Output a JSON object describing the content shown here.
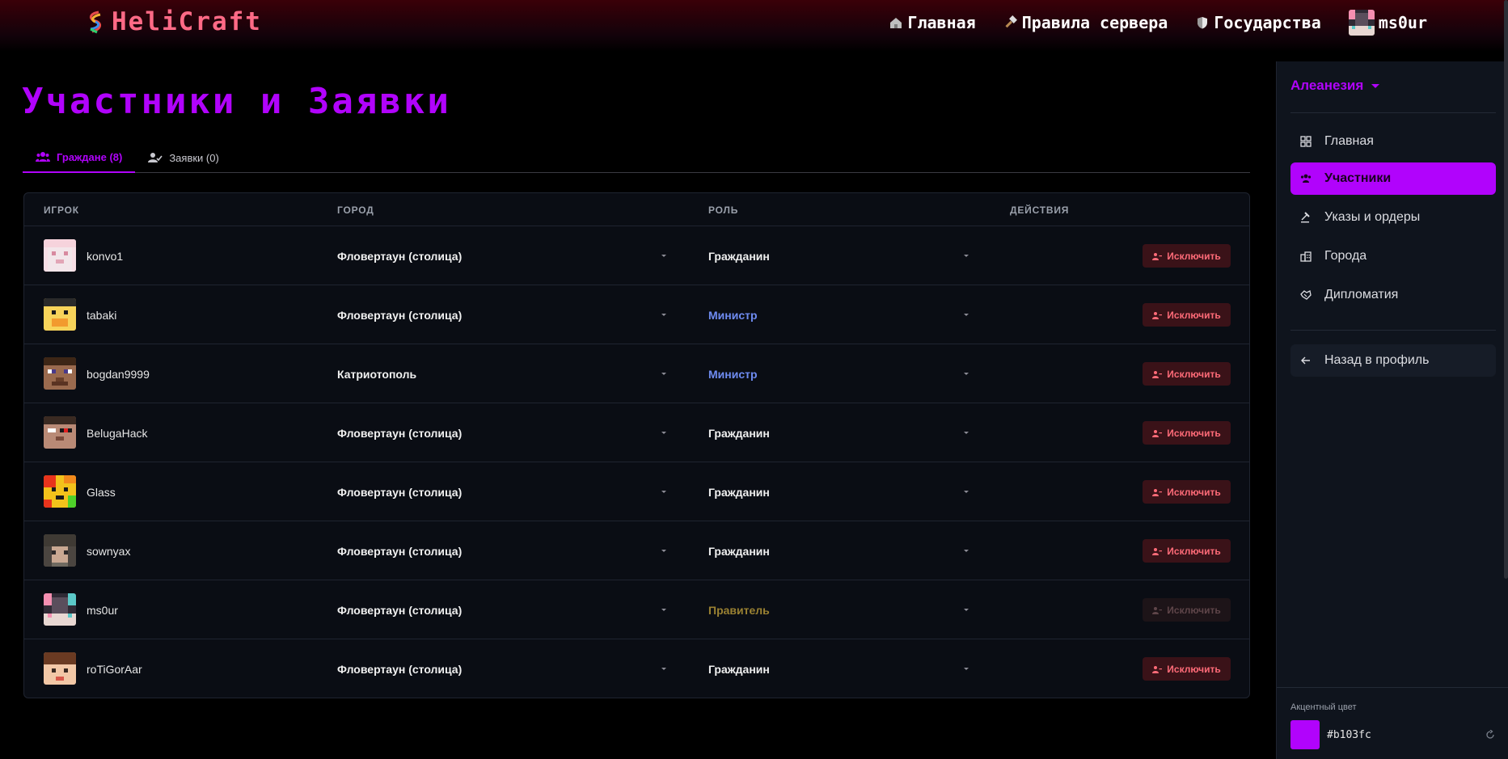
{
  "brand": {
    "name": "HeliCraft"
  },
  "nav": {
    "home": "Главная",
    "rules": "Правила сервера",
    "states": "Государства",
    "user": "ms0ur"
  },
  "page": {
    "title": "Участники и Заявки"
  },
  "tabs": [
    {
      "label": "Граждане (8)",
      "active": true
    },
    {
      "label": "Заявки (0)",
      "active": false
    }
  ],
  "table": {
    "headers": {
      "player": "ИГРОК",
      "city": "ГОРОД",
      "role": "РОЛЬ",
      "actions": "ДЕЙСТВИЯ"
    },
    "kick_label": "Исключить",
    "rows": [
      {
        "player": "konvo1",
        "city": "Фловертаун (столица)",
        "role": "Гражданин",
        "role_color": "#f0f0f0",
        "kick_enabled": true
      },
      {
        "player": "tabaki",
        "city": "Фловертаун (столица)",
        "role": "Министр",
        "role_color": "#6f8cf2",
        "kick_enabled": true
      },
      {
        "player": "bogdan9999",
        "city": "Катриотополь",
        "role": "Министр",
        "role_color": "#6f8cf2",
        "kick_enabled": true
      },
      {
        "player": "BelugaHack",
        "city": "Фловертаун (столица)",
        "role": "Гражданин",
        "role_color": "#f0f0f0",
        "kick_enabled": true
      },
      {
        "player": "Glass",
        "city": "Фловертаун (столица)",
        "role": "Гражданин",
        "role_color": "#f0f0f0",
        "kick_enabled": true
      },
      {
        "player": "sownyax",
        "city": "Фловертаун (столица)",
        "role": "Гражданин",
        "role_color": "#f0f0f0",
        "kick_enabled": true
      },
      {
        "player": "ms0ur",
        "city": "Фловертаун (столица)",
        "role": "Правитель",
        "role_color": "#9a8132",
        "kick_enabled": false
      },
      {
        "player": "roTiGorAar",
        "city": "Фловертаун (столица)",
        "role": "Гражданин",
        "role_color": "#f0f0f0",
        "kick_enabled": true
      }
    ]
  },
  "sidebar": {
    "state_name": "Алеанезия",
    "items": [
      {
        "label": "Главная",
        "icon": "grid-icon",
        "active": false
      },
      {
        "label": "Участники",
        "icon": "users-icon",
        "active": true
      },
      {
        "label": "Указы и ордеры",
        "icon": "gavel-icon",
        "active": false
      },
      {
        "label": "Города",
        "icon": "city-icon",
        "active": false
      },
      {
        "label": "Дипломатия",
        "icon": "handshake-icon",
        "active": false
      }
    ],
    "back_label": "Назад в профиль",
    "accent_label": "Акцентный цвет",
    "accent_value": "#b103fc"
  },
  "colors": {
    "accent": "#b103fc",
    "brand": "#ff6a86",
    "danger": "#ff6b78"
  }
}
